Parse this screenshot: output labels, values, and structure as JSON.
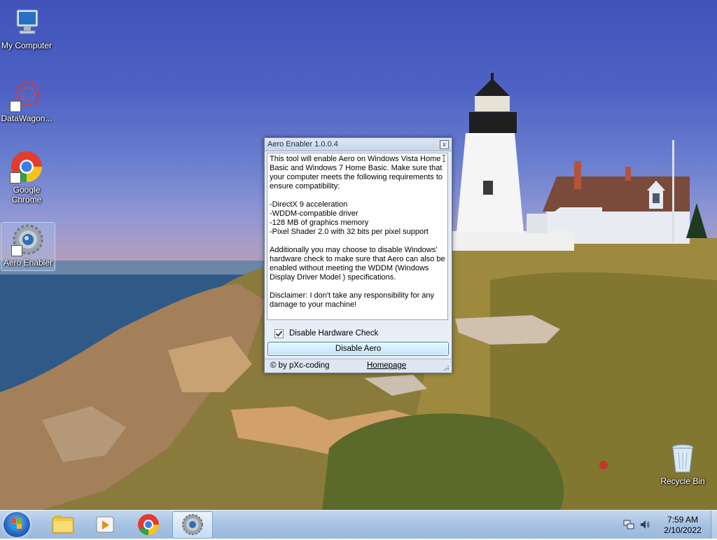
{
  "desktop": {
    "icons": [
      {
        "label": "My Computer",
        "icon": "computer-icon"
      },
      {
        "label": "DataWagon...",
        "icon": "datawagon-icon"
      },
      {
        "label": "Google Chrome",
        "icon": "chrome-icon"
      },
      {
        "label": "Aero Enabler",
        "icon": "aero-enabler-icon"
      },
      {
        "label": "Recycle Bin",
        "icon": "recycle-bin-icon"
      }
    ]
  },
  "dialog": {
    "title": "Aero Enabler 1.0.0.4",
    "close_label": "x",
    "description": "This tool will enable Aero on Windows Vista Home Basic and Windows 7 Home Basic. Make sure that your computer meets the following requirements to ensure compatibility:\n\n-DirectX 9 acceleration\n-WDDM-compatible driver\n-128 MB of graphics memory\n-Pixel Shader 2.0 with 32 bits per pixel support\n\nAdditionally you may choose to disable Windows' hardware check to make sure that Aero can also be enabled without meeting the WDDM (Windows Display Driver Model ) specifications.\n\nDisclaimer: I don't take any responsibility for any damage to your machine!",
    "checkbox_label": "Disable Hardware Check",
    "checkbox_checked": true,
    "button_label": "Disable Aero",
    "copyright": "© by pXc-coding",
    "homepage_link": "Homepage"
  },
  "taskbar": {
    "pinned": [
      "windows-explorer-icon",
      "media-player-icon",
      "chrome-icon",
      "aero-enabler-icon"
    ],
    "active": "aero-enabler-icon",
    "time": "7:59 AM",
    "date": "2/10/2022"
  },
  "colors": {
    "accent": "#3c7fb1",
    "taskbar": "#a7c2e2",
    "dialog_bg": "#e8eef6"
  }
}
